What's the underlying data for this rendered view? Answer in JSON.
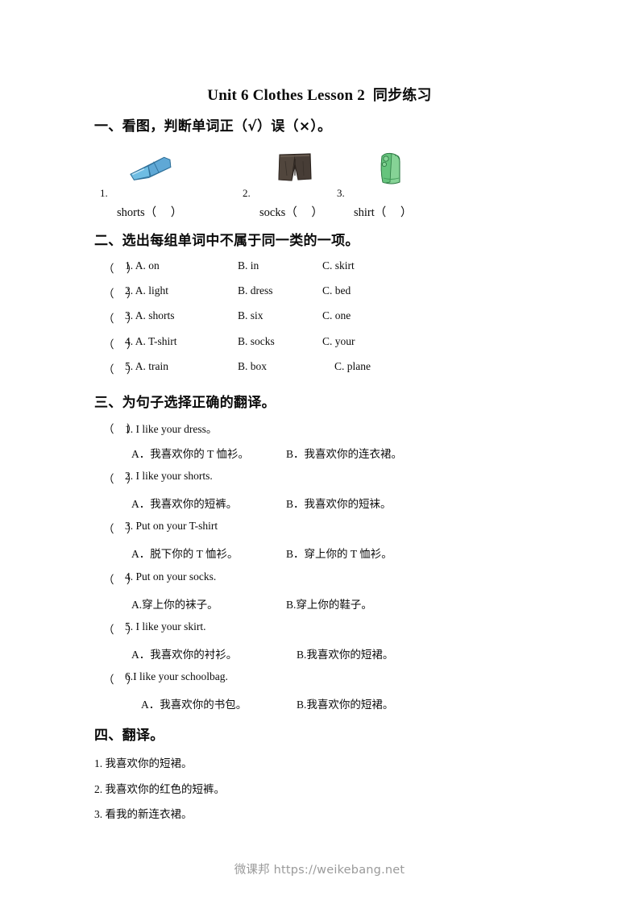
{
  "document": {
    "title_en": "Unit 6 Clothes Lesson 2",
    "title_cn": "同步练习"
  },
  "section1": {
    "heading": "一、看图，判断单词正（√）误（×）。",
    "items": [
      {
        "num": "1.",
        "word": "shorts",
        "paren": "（      ）",
        "art": "blue-shorts-image"
      },
      {
        "num": "2.",
        "word": "socks",
        "paren": "（      ）",
        "art": "brown-shorts-image"
      },
      {
        "num": "3.",
        "word": "shirt",
        "paren": "（      ）",
        "art": "green-shirt-image"
      }
    ]
  },
  "section2": {
    "heading": "二、选出每组单词中不属于同一类的一项。",
    "rows": [
      {
        "bracket": "（    ）",
        "a": "1. A. on",
        "b": "B. in",
        "c": "C. skirt"
      },
      {
        "bracket": "（    ）",
        "a": "2. A. light",
        "b": "B. dress",
        "c": "C. bed"
      },
      {
        "bracket": "（    ）",
        "a": "3. A. shorts",
        "b": "B. six",
        "c": "C. one"
      },
      {
        "bracket": "（    ）",
        "a": "4. A. T-shirt",
        "b": "B. socks",
        "c": "C. your"
      },
      {
        "bracket": "（    ）",
        "a": "5. A. train",
        "b": "B. box",
        "c": "C. plane"
      }
    ]
  },
  "section3": {
    "heading": "三、为句子选择正确的翻译。",
    "questions": [
      {
        "bracket": "（    ）",
        "stem": "1. I like your dress。",
        "option_a": "A．我喜欢你的 T 恤衫。",
        "option_b": "B．我喜欢你的连衣裙。"
      },
      {
        "bracket": "（    ）",
        "stem": "2. I like your shorts.",
        "option_a": "A．我喜欢你的短裤。",
        "option_b": "B．我喜欢你的短袜。"
      },
      {
        "bracket": "（    ）",
        "stem": "3. Put on your T-shirt",
        "option_a": "A．脱下你的 T 恤衫。",
        "option_b": "B．穿上你的 T 恤衫。"
      },
      {
        "bracket": "（    ）",
        "stem": "4. Put on your socks.",
        "option_a": "A.穿上你的袜子。",
        "option_b": "B.穿上你的鞋子。"
      },
      {
        "bracket": "（    ）",
        "stem": "5. I like your skirt.",
        "option_a": "A．我喜欢你的衬衫。",
        "option_b": "B.我喜欢你的短裙。"
      },
      {
        "bracket": "（    ）",
        "stem": "6.I like your schoolbag.",
        "option_a": "A．我喜欢你的书包。",
        "option_b": "B.我喜欢你的短裙。"
      }
    ]
  },
  "section4": {
    "heading": "四、翻译。",
    "lines": [
      "1. 我喜欢你的短裙。",
      "2. 我喜欢你的红色的短裤。",
      "3. 看我的新连衣裙。"
    ]
  },
  "footer": {
    "watermark": "微课邦 https://weikebang.net"
  },
  "colors": {
    "page_background": "#ffffff",
    "text": "#0b0b0b",
    "watermark": "#9a9a9a",
    "art_blue_light": "#8fd0ee",
    "art_blue_mid": "#5fa8d6",
    "art_blue_dark": "#3d7fae",
    "art_brown_dark": "#473d36",
    "art_brown_mid": "#5a4f45",
    "art_green_light": "#86d396",
    "art_green_mid": "#5db974",
    "art_green_dark": "#3f9a58"
  }
}
